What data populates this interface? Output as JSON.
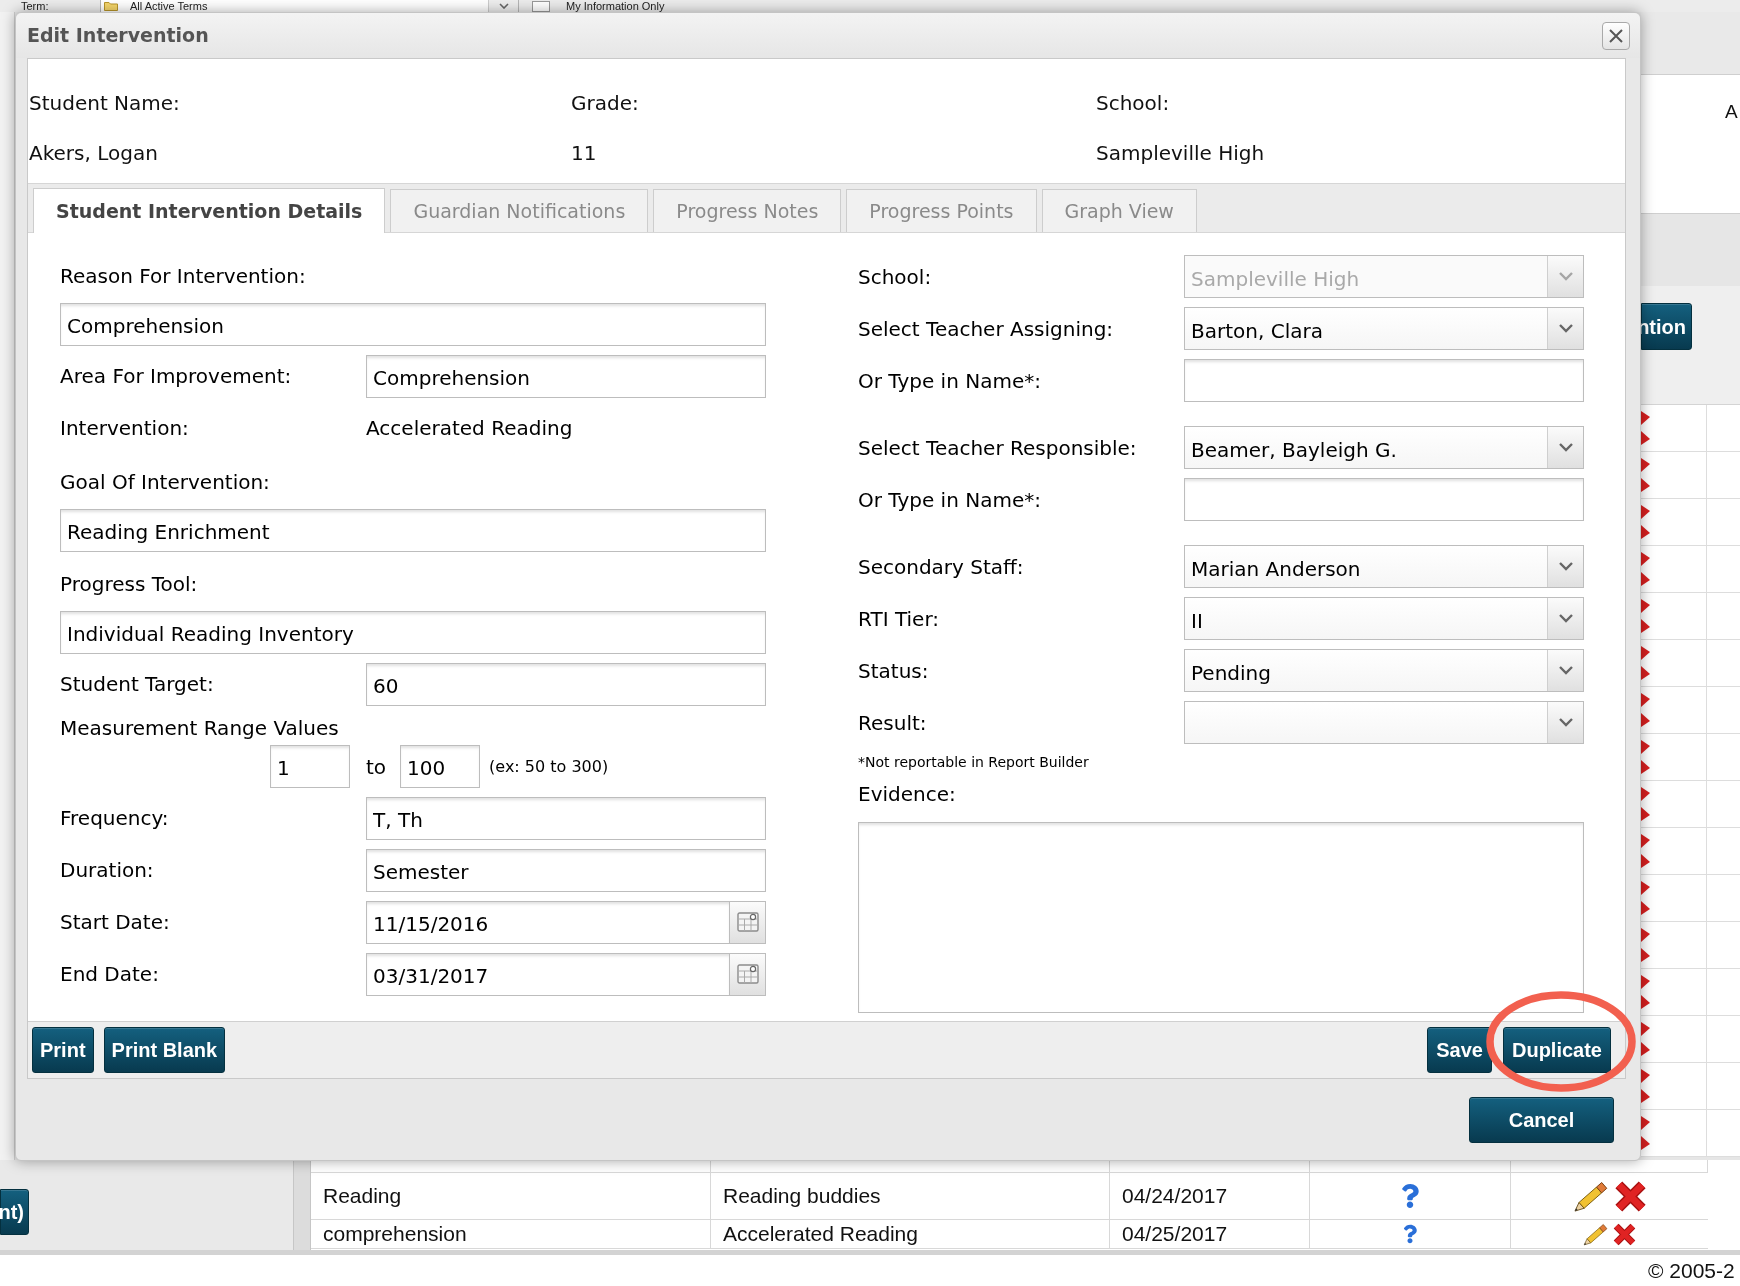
{
  "filter_bar": {
    "term_label": "Term:",
    "term_select": "All Active Terms",
    "my_information_only": {
      "label": "My Information Only",
      "checked": false
    }
  },
  "dialog": {
    "title": "Edit Intervention",
    "student": [
      {
        "label": "Student Name:",
        "value": "Akers, Logan"
      },
      {
        "label": "Grade:",
        "value": "11"
      },
      {
        "label": "School:",
        "value": "Sampleville High"
      }
    ],
    "tabs": [
      {
        "label": "Student Intervention Details",
        "selected": true
      },
      {
        "label": "Guardian Notifications",
        "selected": false
      },
      {
        "label": "Progress Notes",
        "selected": false
      },
      {
        "label": "Progress Points",
        "selected": false
      },
      {
        "label": "Graph View",
        "selected": false
      }
    ],
    "left_fields": [
      {
        "kind": "stacked_input",
        "label": "Reason For Intervention:",
        "value": "Comprehension"
      },
      {
        "kind": "input",
        "label": "Area For Improvement:",
        "value": "Comprehension"
      },
      {
        "kind": "text",
        "label": "Intervention:",
        "value": "Accelerated Reading"
      },
      {
        "kind": "stacked_input",
        "label": "Goal Of Intervention:",
        "value": "Reading Enrichment"
      },
      {
        "kind": "stacked_input",
        "label": "Progress Tool:",
        "value": "Individual Reading Inventory"
      },
      {
        "kind": "input",
        "label": "Student Target:",
        "value": "60"
      },
      {
        "kind": "range",
        "label": "Measurement Range Values",
        "from": "1",
        "separator": "to",
        "to": "100",
        "hint": "(ex: 50 to 300)"
      },
      {
        "kind": "input",
        "label": "Frequency:",
        "value": "T, Th"
      },
      {
        "kind": "input",
        "label": "Duration:",
        "value": "Semester"
      },
      {
        "kind": "date",
        "label": "Start Date:",
        "value": "11/15/2016"
      },
      {
        "kind": "date",
        "label": "End Date:",
        "value": "03/31/2017"
      }
    ],
    "right_fields": [
      {
        "kind": "select",
        "label": "School:",
        "value": "Sampleville High",
        "disabled": true
      },
      {
        "kind": "select",
        "label": "Select Teacher Assigning:",
        "value": "Barton, Clara",
        "disabled": false
      },
      {
        "kind": "input",
        "label": "Or Type in Name*:"
      },
      {
        "kind": "select",
        "label": "Select Teacher Responsible:",
        "value": "Beamer, Bayleigh G.",
        "disabled": false
      },
      {
        "kind": "input",
        "label": "Or Type in Name*:"
      },
      {
        "kind": "select",
        "label": "Secondary Staff:",
        "value": "Marian Anderson",
        "disabled": false
      },
      {
        "kind": "select",
        "label": "RTI Tier:",
        "value": "II",
        "disabled": false
      },
      {
        "kind": "select",
        "label": "Status:",
        "value": "Pending",
        "disabled": false
      },
      {
        "kind": "select",
        "label": "Result:",
        "disabled": false
      },
      {
        "kind": "note",
        "text": "*Not reportable in Report Builder"
      },
      {
        "kind": "textarea",
        "label": "Evidence:"
      }
    ],
    "buttons_left": [
      "Print",
      "Print Blank"
    ],
    "buttons_right": [
      "Save",
      "Duplicate"
    ],
    "cancel": "Cancel"
  },
  "right_panel": {
    "text": "A",
    "button": "ntion"
  },
  "left_panel": {
    "button": "nt)"
  },
  "table": {
    "rows": [
      {
        "cells": [
          "Reading",
          "Reading buddies",
          "04/24/2017"
        ]
      },
      {
        "cells": [
          "comprehension",
          "Accelerated Reading",
          "04/25/2017"
        ]
      }
    ]
  },
  "footer": {
    "copyright": "© 2005-2"
  }
}
